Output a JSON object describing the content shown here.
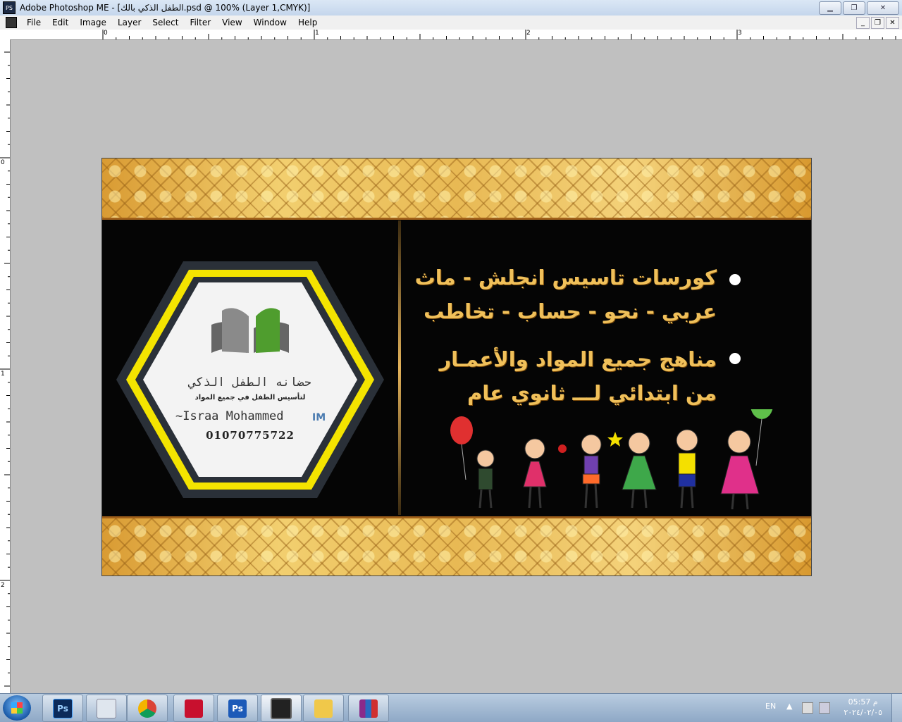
{
  "window": {
    "title": "Adobe Photoshop ME - [الطفل الذكي بالك.psd @ 100% (Layer 1,CMYK)]",
    "app_icon": "PS",
    "min_label": "▁",
    "restore_label": "❐",
    "close_label": "✕"
  },
  "menu": {
    "items": [
      "File",
      "Edit",
      "Image",
      "Layer",
      "Select",
      "Filter",
      "View",
      "Window",
      "Help"
    ],
    "doc_min": "_",
    "doc_restore": "❐",
    "doc_close": "✕"
  },
  "rulers": {
    "h_labels": [
      "0",
      "1",
      "2",
      "3"
    ],
    "v_labels": [
      "0",
      "1",
      "2"
    ]
  },
  "card": {
    "line1": "كورسات تاسيس انجلش - ماث",
    "line2": "عربي - نحو - حساب - تخاطب",
    "line3": "مناهج جميع المواد والأعمـار",
    "line4": "من ابتدائي لـــ ثانوي عام",
    "logo_title": "حضانه الطفل الذكي",
    "logo_subtitle": "لتأسيس الطفل في جميع المواد",
    "designer": "~Israa Mohammed",
    "phone": "01070775722",
    "designer_mark": "IM",
    "colors": {
      "gold": "#f0c05a",
      "hex_yellow": "#f4e400",
      "hex_dark": "#2a3038",
      "background": "#050505"
    }
  },
  "taskbar": {
    "apps": [
      {
        "name": "photoshop",
        "label": "Ps"
      },
      {
        "name": "calculator",
        "label": ""
      },
      {
        "name": "chrome",
        "label": ""
      },
      {
        "name": "acrobat",
        "label": ""
      },
      {
        "name": "photoshop-2",
        "label": "Ps"
      },
      {
        "name": "eye-app",
        "label": ""
      },
      {
        "name": "file-explorer",
        "label": ""
      },
      {
        "name": "winrar",
        "label": ""
      }
    ],
    "language": "EN",
    "time": "05:57 م",
    "date": "٢٠٢٤/٠٢/٠٥"
  }
}
